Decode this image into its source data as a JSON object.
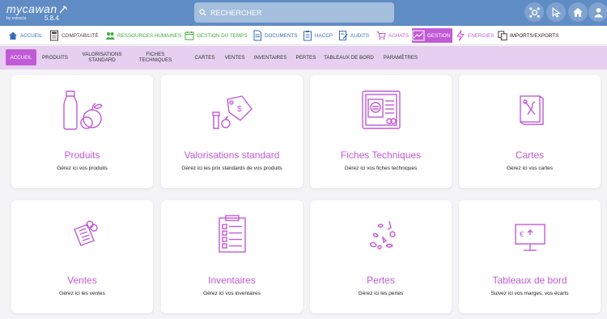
{
  "brand": {
    "name": "mycawan",
    "by": "by extracta",
    "version": "5.8.4"
  },
  "search": {
    "label": "RECHERCHER"
  },
  "modules": [
    {
      "label": "ACCUEIL",
      "icon": "home-icon",
      "color": "#3a6fb7"
    },
    {
      "label": "COMPTABILITÉ",
      "icon": "calculator-icon",
      "color": "#444444"
    },
    {
      "label": "RESSOURCES HUMAINES",
      "icon": "people-icon",
      "color": "#3cae3c"
    },
    {
      "label": "GESTION DU TEMPS",
      "icon": "calendar-icon",
      "color": "#3cae3c"
    },
    {
      "label": "DOCUMENTS",
      "icon": "document-icon",
      "color": "#3a6fb7"
    },
    {
      "label": "HACCP",
      "icon": "clipboard-icon",
      "color": "#3a6fb7"
    },
    {
      "label": "AUDITS",
      "icon": "audit-icon",
      "color": "#3a6fb7"
    },
    {
      "label": "ACHATS",
      "icon": "cart-icon",
      "color": "#c15ad6"
    },
    {
      "label": "GESTION",
      "icon": "chart-icon",
      "color": "#ffffff",
      "active": true
    },
    {
      "label": "ENERGIES",
      "icon": "lightning-icon",
      "color": "#c15ad6"
    },
    {
      "label": "IMPORTS/EXPORTS",
      "icon": "import-export-icon",
      "color": "#222222"
    }
  ],
  "subnav": [
    {
      "label": "ACCUEIL",
      "active": true
    },
    {
      "label": "PRODUITS"
    },
    {
      "label": "VALORISATIONS\nSTANDARD"
    },
    {
      "label": "FICHES\nTECHNIQUES"
    },
    {
      "label": "CARTES"
    },
    {
      "label": "VENTES"
    },
    {
      "label": "INVENTAIRES"
    },
    {
      "label": "PERTES"
    },
    {
      "label": "TABLEAUX DE BORD"
    },
    {
      "label": "PARAMÈTRES"
    }
  ],
  "cards": [
    {
      "title": "Produits",
      "desc": "Gérez ici vos produits",
      "icon": "products-icon"
    },
    {
      "title": "Valorisations standard",
      "desc": "Gérez ici les prix standards de vos produits",
      "icon": "price-tag-icon"
    },
    {
      "title": "Fiches Techniques",
      "desc": "Gérez ici vos fiches techniques",
      "icon": "recipe-sheet-icon"
    },
    {
      "title": "Cartes",
      "desc": "Gérez ici vos cartes",
      "icon": "menu-card-icon"
    },
    {
      "title": "Ventes",
      "desc": "Gérez ici les ventes",
      "icon": "sales-receipt-icon"
    },
    {
      "title": "Inventaires",
      "desc": "Gérez ici vos inventaires",
      "icon": "inventory-checklist-icon"
    },
    {
      "title": "Pertes",
      "desc": "Gérez ici les pertes",
      "icon": "waste-icon"
    },
    {
      "title": "Tableaux de bord",
      "desc": "Suivez ici vos marges, vos écarts",
      "icon": "dashboard-board-icon"
    }
  ],
  "colors": {
    "header": "#5f8cc5",
    "accent": "#c15ad6",
    "subnav": "#e6cff0"
  }
}
